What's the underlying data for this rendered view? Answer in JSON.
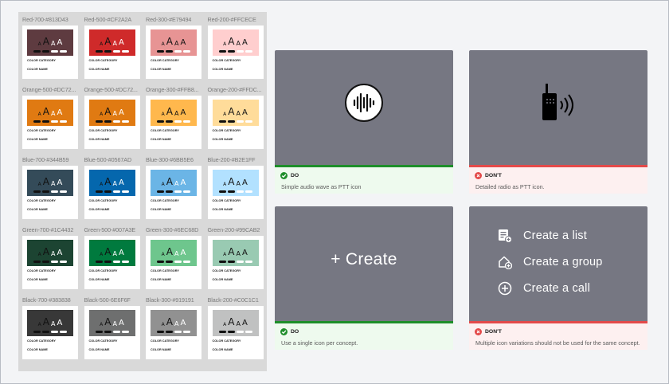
{
  "swatches": [
    {
      "label": "Red-700-#813D43",
      "color": "#5e3b40"
    },
    {
      "label": "Red-500-#CF2A2A",
      "color": "#cf2a2a"
    },
    {
      "label": "Red-300-#E79494",
      "color": "#e79494"
    },
    {
      "label": "Red-200-#FFCECE",
      "color": "#ffcece"
    },
    {
      "label": "Orange-500-#DC72...",
      "color": "#e07a12"
    },
    {
      "label": "Orange-500-#DC72...",
      "color": "#e07a12"
    },
    {
      "label": "Orange-300-#FFB8...",
      "color": "#ffb84d"
    },
    {
      "label": "Orange-200-#FFDC...",
      "color": "#ffdc9a"
    },
    {
      "label": "Blue-700-#344B59",
      "color": "#344b59"
    },
    {
      "label": "Blue-500-#0567AD",
      "color": "#0567ad"
    },
    {
      "label": "Blue-300-#6BB5E6",
      "color": "#6bb5e6"
    },
    {
      "label": "Blue-200-#B2E1FF",
      "color": "#b2e1ff"
    },
    {
      "label": "Green-700-#1C4432",
      "color": "#1c4432"
    },
    {
      "label": "Green-500-#007A3E",
      "color": "#007a3e"
    },
    {
      "label": "Green-300-#6EC68D",
      "color": "#6ec68d"
    },
    {
      "label": "Green-200-#99CAB2",
      "color": "#99cab2"
    },
    {
      "label": "Black-700-#383838",
      "color": "#383838"
    },
    {
      "label": "Black-500-6E6F6F",
      "color": "#6e6f6f"
    },
    {
      "label": "Black-300-#919191",
      "color": "#919191"
    },
    {
      "label": "Black-200-#C0C1C1",
      "color": "#c0c1c1"
    }
  ],
  "swatch_card": {
    "category_title": "COLOR CATEGORY",
    "name_title": "COLOR NAME"
  },
  "guidelines": {
    "audio_do": {
      "verdict": "DO",
      "caption": "Simple audio wave as PTT icon"
    },
    "radio_dont": {
      "verdict": "DON'T",
      "caption": "Detailed radio as PTT icon."
    },
    "create_do": {
      "verdict": "DO",
      "caption": "Use a single icon per concept.",
      "button_text": "+ Create"
    },
    "menu_dont": {
      "verdict": "DON'T",
      "caption": "Multiple icon variations should not be used for the same concept.",
      "items": [
        "Create a list",
        "Create a group",
        "Create a call"
      ]
    }
  },
  "colors": {
    "do_green": "#1e8e2a",
    "dont_red": "#e34a4a",
    "do_bg": "#eefaee",
    "dont_bg": "#fdf0f0",
    "tile_gray": "#767782"
  }
}
